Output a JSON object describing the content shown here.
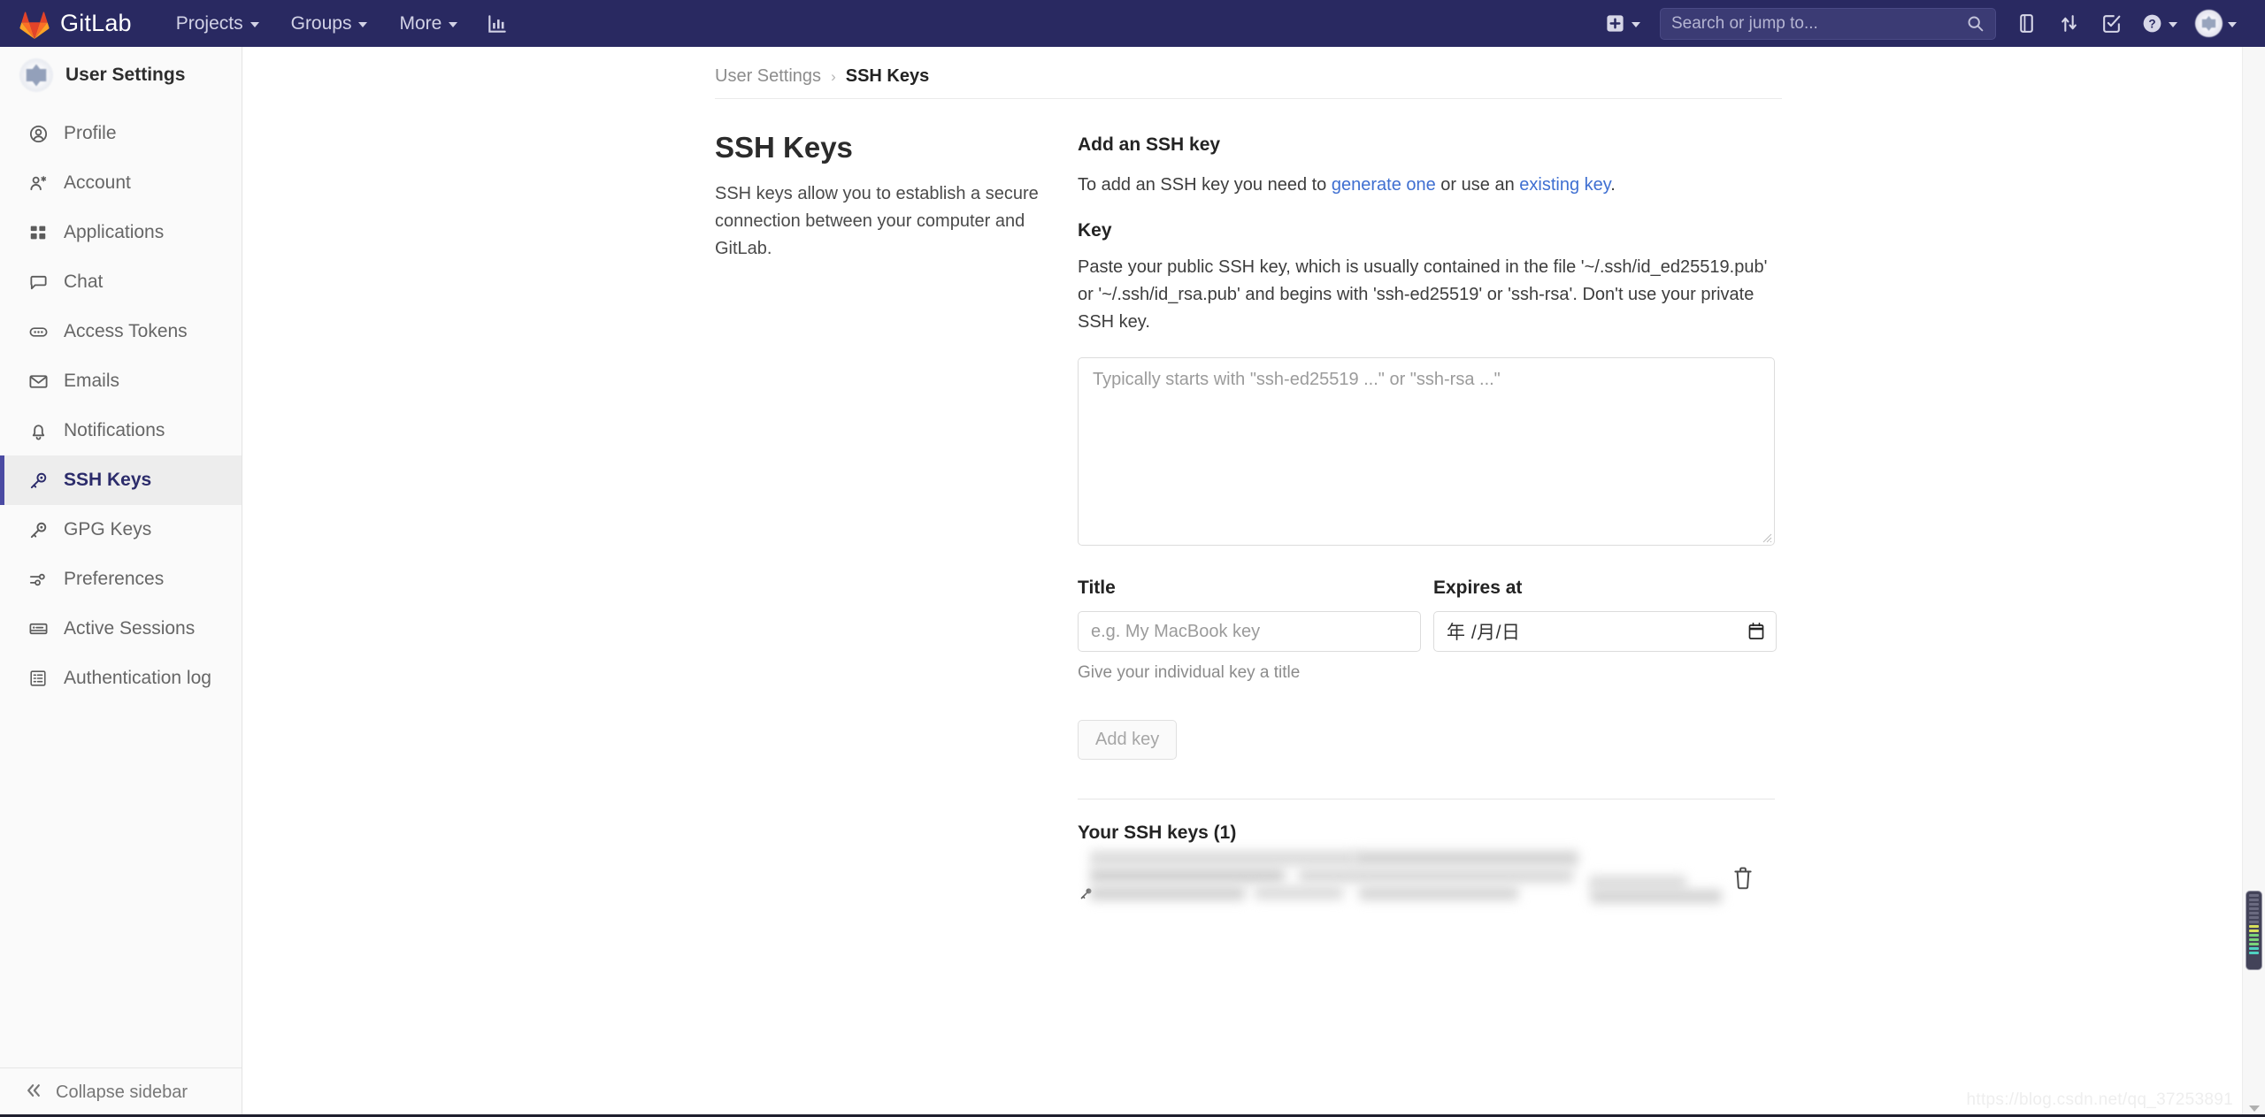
{
  "navbar": {
    "brand": "GitLab",
    "items": [
      {
        "label": "Projects",
        "icon": "chevron-down-icon"
      },
      {
        "label": "Groups",
        "icon": "chevron-down-icon"
      },
      {
        "label": "More",
        "icon": "chevron-down-icon"
      }
    ],
    "analytics_icon": "bar-chart-icon",
    "plus_icon": "plus-square-icon",
    "search": {
      "placeholder": "Search or jump to...",
      "value": "",
      "icon": "search-icon"
    },
    "right_icons": [
      {
        "name": "issues-icon",
        "label": "Issues"
      },
      {
        "name": "merge-requests-icon",
        "label": "Merge requests"
      },
      {
        "name": "todos-icon",
        "label": "To-Do List"
      },
      {
        "name": "help-icon",
        "label": "Help"
      }
    ],
    "avatar_icon": "user-avatar-icon",
    "bg_color": "#292961"
  },
  "sidebar": {
    "header": {
      "title": "User Settings",
      "avatar_icon": "user-avatar-icon"
    },
    "items": [
      {
        "label": "Profile",
        "icon": "profile-icon",
        "active": false
      },
      {
        "label": "Account",
        "icon": "account-icon",
        "active": false
      },
      {
        "label": "Applications",
        "icon": "applications-icon",
        "active": false
      },
      {
        "label": "Chat",
        "icon": "chat-icon",
        "active": false
      },
      {
        "label": "Access Tokens",
        "icon": "token-icon",
        "active": false
      },
      {
        "label": "Emails",
        "icon": "envelope-icon",
        "active": false
      },
      {
        "label": "Notifications",
        "icon": "bell-icon",
        "active": false
      },
      {
        "label": "SSH Keys",
        "icon": "key-icon",
        "active": true
      },
      {
        "label": "GPG Keys",
        "icon": "key-icon",
        "active": false
      },
      {
        "label": "Preferences",
        "icon": "sliders-icon",
        "active": false
      },
      {
        "label": "Active Sessions",
        "icon": "monitor-icon",
        "active": false
      },
      {
        "label": "Authentication log",
        "icon": "log-icon",
        "active": false
      }
    ],
    "collapse": {
      "label": "Collapse sidebar",
      "icon": "double-chevron-left-icon"
    },
    "active_accent_color": "#4b4ba3"
  },
  "breadcrumb": {
    "parent": "User Settings",
    "separator": "›",
    "current": "SSH Keys"
  },
  "page": {
    "title": "SSH Keys",
    "description": "SSH keys allow you to establish a secure connection between your computer and GitLab."
  },
  "form": {
    "section_title": "Add an SSH key",
    "intro_pre": "To add an SSH key you need to ",
    "intro_link_1": "generate one",
    "intro_mid": " or use an ",
    "intro_link_2": "existing key",
    "intro_post": ".",
    "key_label": "Key",
    "key_help": "Paste your public SSH key, which is usually contained in the file '~/.ssh/id_ed25519.pub' or '~/.ssh/id_rsa.pub' and begins with 'ssh-ed25519' or 'ssh-rsa'. Don't use your private SSH key.",
    "key_placeholder": "Typically starts with \"ssh-ed25519 ...\" or \"ssh-rsa ...\"",
    "key_value": "",
    "title_label": "Title",
    "title_placeholder": "e.g. My MacBook key",
    "title_value": "",
    "title_helper": "Give your individual key a title",
    "expires_label": "Expires at",
    "expires_placeholder": "年 /月/日",
    "expires_value": "",
    "expires_icon": "calendar-icon",
    "submit_label": "Add key",
    "submit_disabled": true
  },
  "keys_list": {
    "heading": "Your SSH keys (1)",
    "rows": [
      {
        "redacted": true,
        "row_icon": "key-icon",
        "delete_icon": "trash-icon"
      }
    ]
  },
  "status": {
    "watermark": "https://blog.csdn.net/qq_37253891"
  },
  "scrollbar": {
    "icon": "scrollbar-thumb",
    "arrow_icon": "chevron-down-icon"
  }
}
